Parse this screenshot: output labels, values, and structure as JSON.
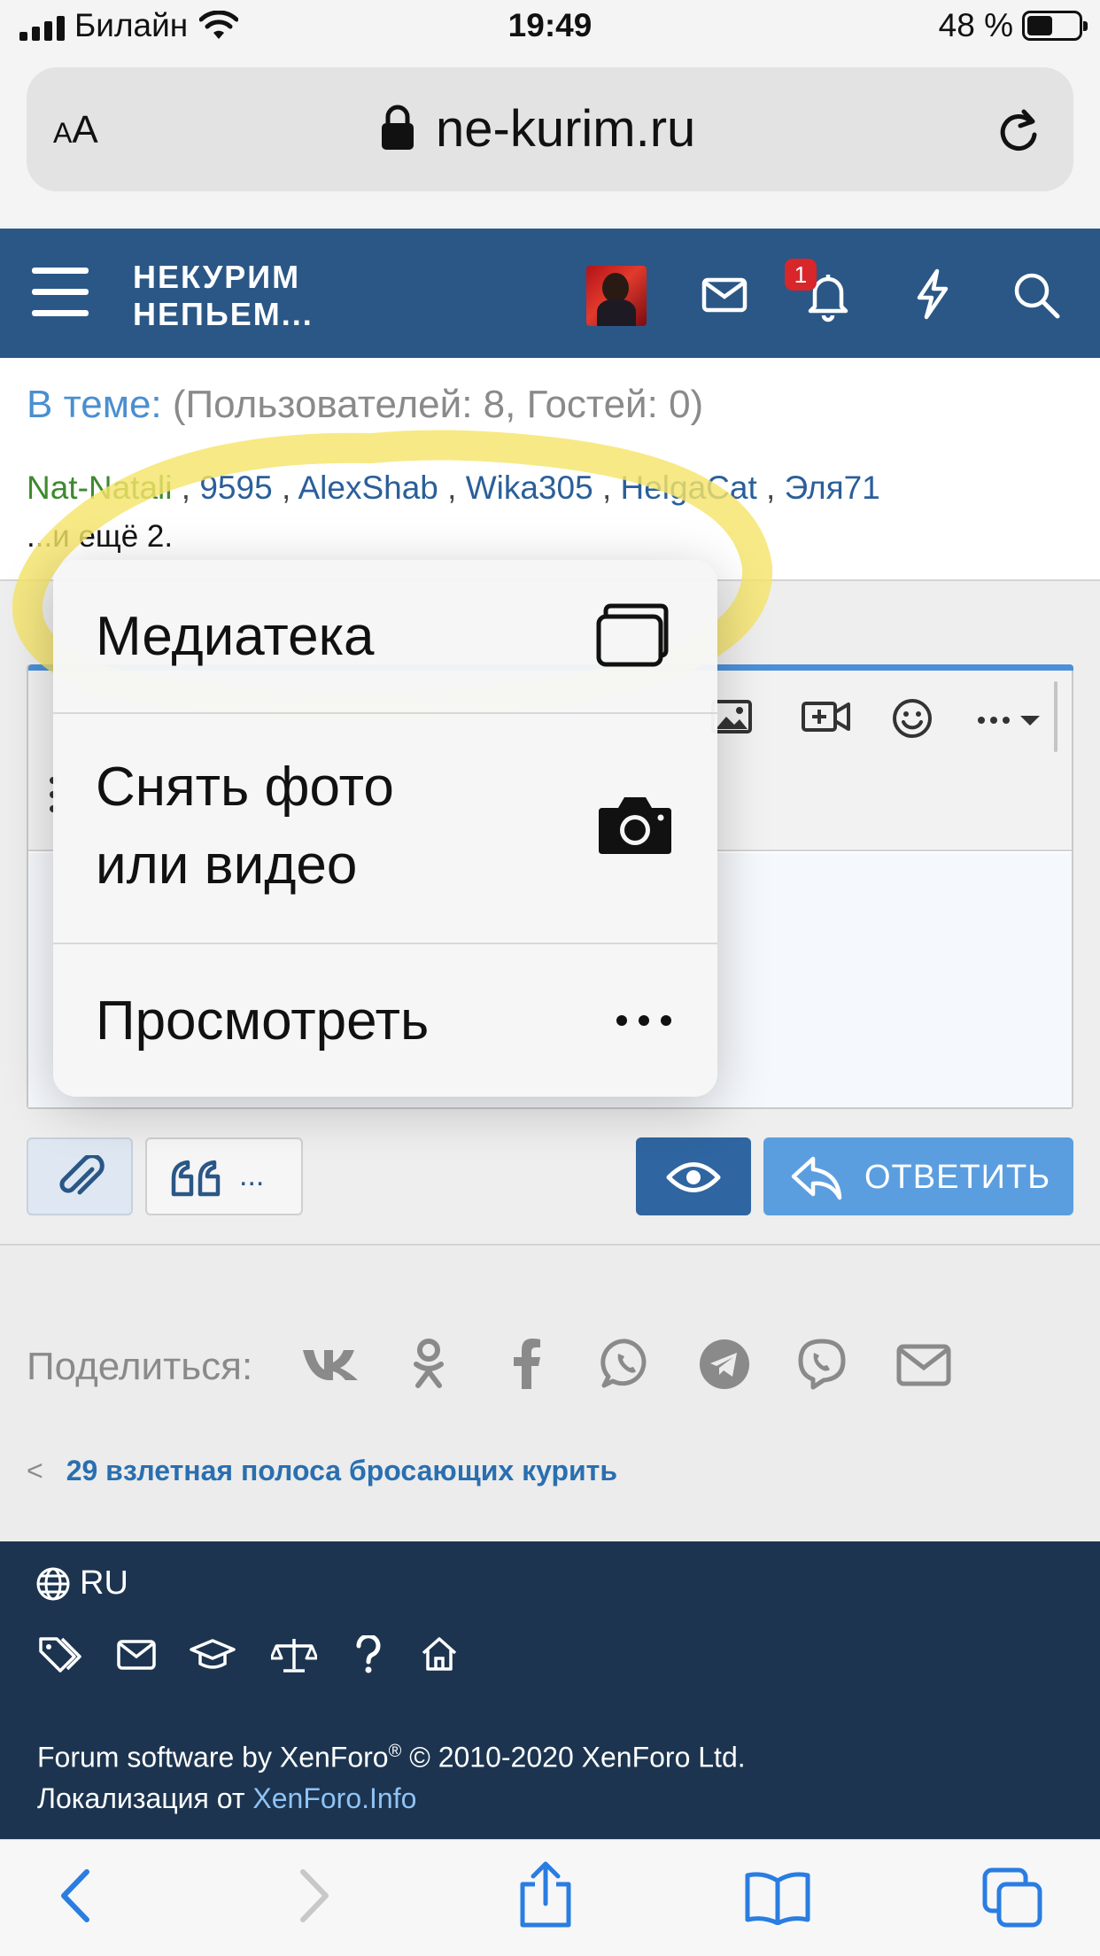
{
  "status_bar": {
    "carrier": "Билайн",
    "time": "19:49",
    "battery": "48 %"
  },
  "browser": {
    "text_size_small": "A",
    "text_size_large": "A",
    "url": "ne-kurim.ru"
  },
  "forum_header": {
    "logo_line1": "НЕКУРИМ",
    "logo_line2": "НЕПЬЕМ...",
    "notification_count": "1"
  },
  "online": {
    "title_lead": "В теме:",
    "title_rest": "(Пользователей: 8, Гостей: 0)",
    "users": [
      {
        "name": "Nat-Natali",
        "color": "#3d8b2d"
      },
      {
        "name": "9595",
        "color": "#2a5f9a"
      },
      {
        "name": "AlexShab",
        "color": "#2a5f9a"
      },
      {
        "name": "Wika305",
        "color": "#2a5f9a"
      },
      {
        "name": "HelgaCat",
        "color": "#2a5f9a"
      },
      {
        "name": "Эля71",
        "color": "#2a5f9a"
      }
    ],
    "separator": ",",
    "more": "...и ещё 2."
  },
  "context_menu": {
    "items": [
      {
        "label": "Медиатека",
        "icon": "photo-library-icon"
      },
      {
        "label_line1": "Снять фото",
        "label_line2": "или видео",
        "icon": "camera-icon"
      },
      {
        "label": "Просмотреть",
        "icon": "ellipsis-icon"
      }
    ]
  },
  "editor": {
    "quote_more": "...",
    "reply_label": "ОТВЕТИТЬ"
  },
  "share": {
    "label": "Поделиться:",
    "networks": [
      "vk-icon",
      "odnoklassniki-icon",
      "facebook-icon",
      "whatsapp-icon",
      "telegram-icon",
      "viber-icon",
      "email-icon"
    ]
  },
  "thread_link": "29 взлетная полоса бросающих курить",
  "footer": {
    "language": "RU",
    "copyright_prefix": "Forum software by XenForo",
    "copyright_mark": "®",
    "copyright_suffix": " © 2010-2020 XenForo Ltd.",
    "localization_prefix": "Локализация от ",
    "localization_link": "XenForo.Info"
  },
  "colors": {
    "header_bg": "#2a5786",
    "footer_bg": "#1c344f",
    "accent": "#4a90d9",
    "highlight": "#f5e46a",
    "badge": "#d8262b"
  }
}
